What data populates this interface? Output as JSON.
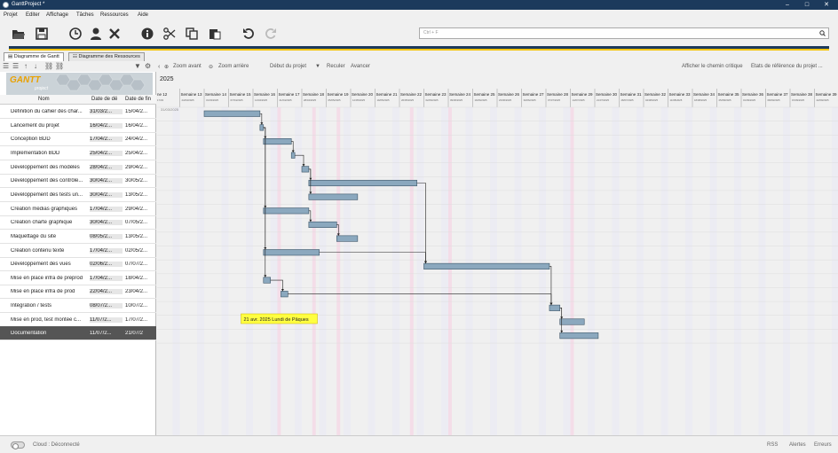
{
  "window": {
    "title": "GanttProject *"
  },
  "menu": [
    "Projet",
    "Editer",
    "Affichage",
    "Tâches",
    "Ressources",
    "Aide"
  ],
  "search": {
    "placeholder": "Ctrl + F"
  },
  "tabs": [
    {
      "label": "Diagramme de Gantt"
    },
    {
      "label": "Diagramme des Ressources"
    }
  ],
  "logo": {
    "text": "GANTT",
    "sub": "project"
  },
  "columns": {
    "name": "Nom",
    "start": "Date de dé",
    "end": "Date de fin"
  },
  "toolbar_chart": {
    "zoom_in": "Zoom avant",
    "zoom_out": "Zoom arrière",
    "project_start": "Début du projet",
    "back": "Reculer",
    "forward": "Avancer",
    "critical_path": "Afficher le chemin critique",
    "baselines": "Etats de référence du projet ..."
  },
  "year": "2025",
  "weeks": [
    "ine 12",
    "Semaine 13",
    "Semaine 14",
    "Semaine 15",
    "Semaine 16",
    "Semaine 17",
    "Semaine 18",
    "Semaine 19",
    "Semaine 20",
    "Semaine 21",
    "Semaine 22",
    "Semaine 23",
    "Semaine 24",
    "Semaine 25",
    "Semaine 26",
    "Semaine 27",
    "Semaine 28",
    "Semaine 29",
    "Semaine 30",
    "Semaine 31",
    "Semaine 32",
    "Semaine 33",
    "Semaine 34",
    "Semaine 35",
    "Semaine 36",
    "Semaine 37",
    "Semaine 38",
    "Semaine 39",
    "Se"
  ],
  "week_dates": [
    "17/03",
    "24/03/2025",
    "31/03/2025",
    "07/04/2025",
    "14/04/2025",
    "21/04/2025",
    "28/04/2025",
    "05/05/2025",
    "12/05/2025",
    "19/05/2025",
    "26/05/2025",
    "02/06/2025",
    "09/06/2025",
    "16/06/2025",
    "23/06/2025",
    "30/06/2025",
    "07/07/2025",
    "14/07/2025",
    "21/07/2025",
    "28/07/2025",
    "04/08/2025",
    "11/08/2025",
    "18/08/2025",
    "25/08/2025",
    "01/09/2025",
    "08/09/2025",
    "15/09/2025",
    "22/09/2025",
    "2"
  ],
  "today_label": "31/03/2025",
  "holiday_tooltip": "21 avr. 2025 Lundi de Pâques",
  "tasks": [
    {
      "name": "Définition du cahier des char...",
      "start": "31/03/2...",
      "end": "15/04/2..."
    },
    {
      "name": "Lancement du projet",
      "start": "16/04/2...",
      "end": "16/04/2..."
    },
    {
      "name": "Conception BDD",
      "start": "17/04/2...",
      "end": "24/04/2..."
    },
    {
      "name": "Implémentation BDD",
      "start": "25/04/2...",
      "end": "25/04/2..."
    },
    {
      "name": "Développement des modèles",
      "start": "28/04/2...",
      "end": "29/04/2..."
    },
    {
      "name": "Développement des contrôle...",
      "start": "30/04/2...",
      "end": "30/05/2..."
    },
    {
      "name": "Développement des tests un...",
      "start": "30/04/2...",
      "end": "13/05/2..."
    },
    {
      "name": "Création médias graphiques",
      "start": "17/04/2...",
      "end": "29/04/2..."
    },
    {
      "name": "Création charte graphique",
      "start": "30/04/2...",
      "end": "07/05/2..."
    },
    {
      "name": "Maquettage du site",
      "start": "08/05/2...",
      "end": "13/05/2..."
    },
    {
      "name": "Création contenu texte",
      "start": "17/04/2...",
      "end": "02/05/2..."
    },
    {
      "name": "Développement des vues",
      "start": "02/06/2...",
      "end": "07/07/2..."
    },
    {
      "name": "Mise en place infra de préprod",
      "start": "17/04/2...",
      "end": "18/04/2..."
    },
    {
      "name": "Mise en place infra de prod",
      "start": "22/04/2...",
      "end": "23/04/2..."
    },
    {
      "name": "Intégration / tests",
      "start": "08/07/2...",
      "end": "10/07/2..."
    },
    {
      "name": "Mise en prod, test montée c...",
      "start": "11/07/2...",
      "end": "17/07/2..."
    },
    {
      "name": "Documentation",
      "start": "11/07/2...",
      "end": "21/07/2"
    }
  ],
  "status": {
    "cloud": "Cloud : Déconnecté",
    "rss": "RSS",
    "alerts": "Alertes",
    "errors": "Erreurs"
  }
}
